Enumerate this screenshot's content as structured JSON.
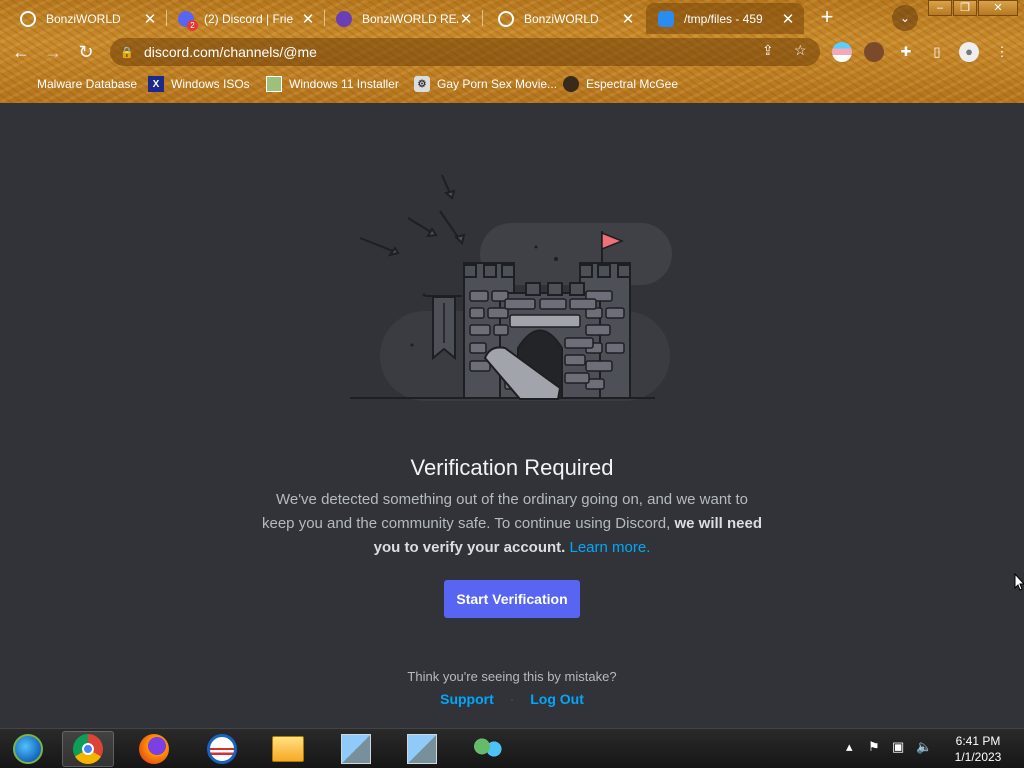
{
  "browser": {
    "tabs": [
      {
        "title": "BonziWORLD",
        "icon": "globe-icon",
        "active": false
      },
      {
        "title": "(2) Discord | Frie",
        "icon": "discord-icon",
        "badge": "2",
        "active": false
      },
      {
        "title": "BonziWORLD REA",
        "icon": "bonzi-icon",
        "active": false
      },
      {
        "title": "BonziWORLD",
        "icon": "globe-icon",
        "active": false
      },
      {
        "title": "/tmp/files - 459",
        "icon": "cloud-icon",
        "active": true
      }
    ],
    "new_tab": "+",
    "url": "discord.com/channels/@me",
    "bookmarks": [
      {
        "label": "Malware Database",
        "icon": "globe-icon"
      },
      {
        "label": "Windows ISOs",
        "icon": "x-icon",
        "icon_text": "X"
      },
      {
        "label": "Windows 11 Installer",
        "icon": "image-icon"
      },
      {
        "label": "Gay Porn Sex Movie...",
        "icon": "robot-icon"
      },
      {
        "label": "Espectral McGee",
        "icon": "face-icon"
      }
    ],
    "window_controls": {
      "minimize": "–",
      "restore": "❐",
      "close": "✕"
    }
  },
  "verification": {
    "title": "Verification Required",
    "body_normal": "We've detected something out of the ordinary going on, and we want to keep you and the community safe. To continue using Discord,",
    "body_bold": "we will need you to verify your account.",
    "learn_more": "Learn more.",
    "button": "Start Verification",
    "mistake_text": "Think you're seeing this by mistake?",
    "support": "Support",
    "separator": "·",
    "logout": "Log Out"
  },
  "taskbar": {
    "apps": [
      "start-orb-icon",
      "chrome-icon",
      "firefox-icon",
      "obama-icon",
      "file-explorer-icon",
      "setup-icon",
      "setup-icon",
      "network-users-icon"
    ],
    "clock_time": "6:41 PM",
    "clock_date": "1/1/2023"
  },
  "colors": {
    "discord_bg": "#313338",
    "blurple": "#5865f2",
    "link": "#00a8fc"
  }
}
